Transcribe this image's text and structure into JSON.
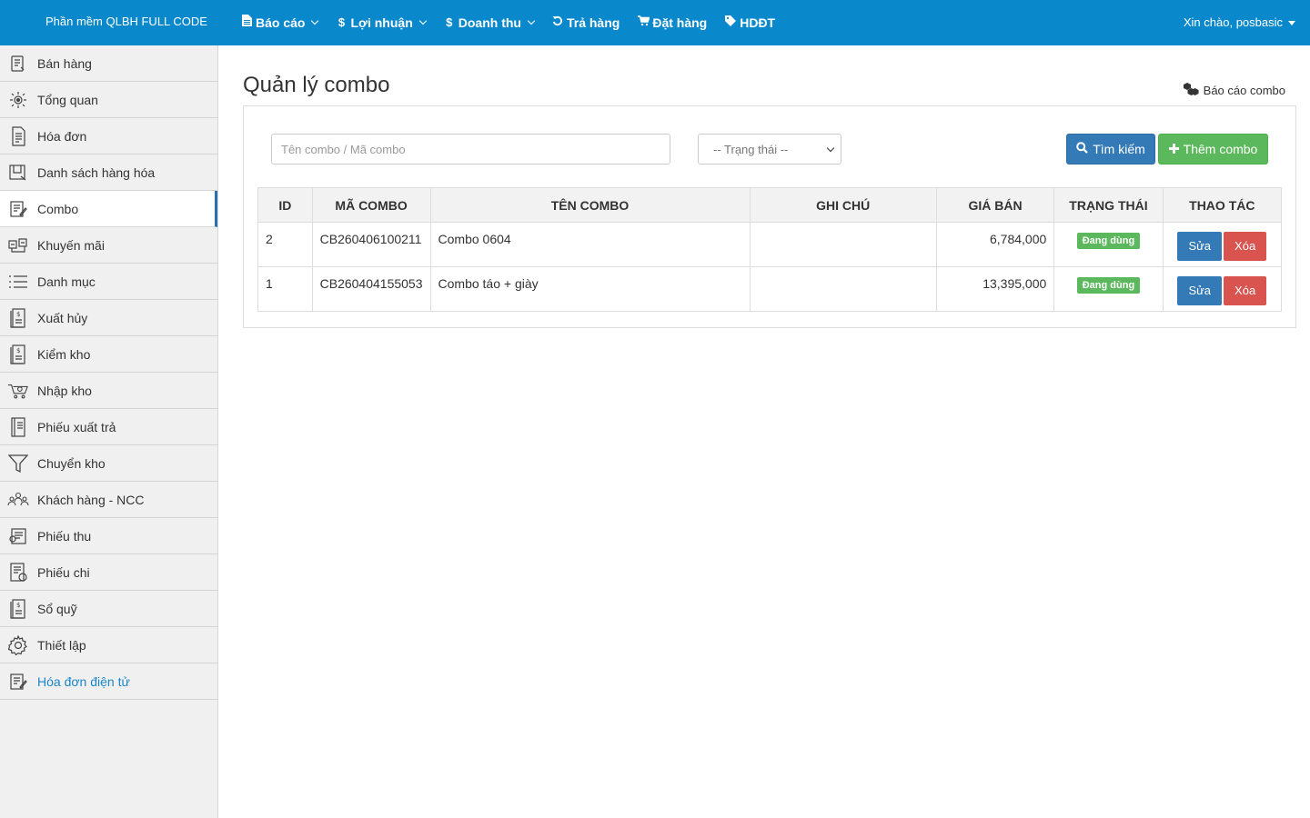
{
  "header": {
    "brand": "Phần mềm QLBH FULL CODE",
    "nav": [
      {
        "label": "Báo cáo",
        "icon": "file-icon",
        "dropdown": true
      },
      {
        "label": "Lợi nhuận",
        "icon": "dollar-icon",
        "dropdown": true
      },
      {
        "label": "Doanh thu",
        "icon": "dollar-icon",
        "dropdown": true
      },
      {
        "label": "Trả hàng",
        "icon": "undo-icon",
        "dropdown": false
      },
      {
        "label": "Đặt hàng",
        "icon": "cart-icon",
        "dropdown": false
      },
      {
        "label": "HDĐT",
        "icon": "tag-icon",
        "dropdown": false
      }
    ],
    "user": "Xin chào, posbasic"
  },
  "sidebar": {
    "items": [
      {
        "label": "Bán hàng",
        "icon": "sales-icon"
      },
      {
        "label": "Tổng quan",
        "icon": "overview-icon"
      },
      {
        "label": "Hóa đơn",
        "icon": "invoice-icon"
      },
      {
        "label": "Danh sách hàng hóa",
        "icon": "product-list-icon"
      },
      {
        "label": "Combo",
        "icon": "combo-icon",
        "active": true
      },
      {
        "label": "Khuyến mãi",
        "icon": "promotion-icon"
      },
      {
        "label": "Danh mục",
        "icon": "list-icon"
      },
      {
        "label": "Xuất hủy",
        "icon": "dollar-doc-icon"
      },
      {
        "label": "Kiểm kho",
        "icon": "dollar-doc-icon"
      },
      {
        "label": "Nhập kho",
        "icon": "cart-icon"
      },
      {
        "label": "Phiếu xuất trả",
        "icon": "notebook-icon"
      },
      {
        "label": "Chuyển kho",
        "icon": "funnel-icon"
      },
      {
        "label": "Khách hàng - NCC",
        "icon": "people-icon"
      },
      {
        "label": "Phiếu thu",
        "icon": "receipt-icon"
      },
      {
        "label": "Phiếu chi",
        "icon": "payment-icon"
      },
      {
        "label": "Sổ quỹ",
        "icon": "dollar-doc-icon"
      },
      {
        "label": "Thiết lập",
        "icon": "gear-icon"
      },
      {
        "label": "Hóa đơn điện tử",
        "icon": "e-invoice-icon",
        "link": true
      }
    ]
  },
  "main": {
    "title": "Quản lý combo",
    "report_link": "Báo cáo combo",
    "search_placeholder": "Tên combo / Mã combo",
    "status_select": "-- Trạng thái --",
    "search_button": "Tìm kiếm",
    "add_button": "Thêm combo",
    "table": {
      "headers": [
        "ID",
        "MÃ COMBO",
        "TÊN COMBO",
        "GHI CHÚ",
        "GIÁ BÁN",
        "TRẠNG THÁI",
        "THAO TÁC"
      ],
      "rows": [
        {
          "id": "2",
          "code": "CB260406100211",
          "name": "Combo 0604",
          "note": "",
          "price": "6,784,000",
          "status": "Đang dùng",
          "edit": "Sửa",
          "delete": "Xóa"
        },
        {
          "id": "1",
          "code": "CB260404155053",
          "name": "Combo táo + giày",
          "note": "",
          "price": "13,395,000",
          "status": "Đang dùng",
          "edit": "Sửa",
          "delete": "Xóa"
        }
      ]
    }
  },
  "colors": {
    "topbar": "#0a88cc",
    "primary": "#337ab7",
    "success": "#5cb85c",
    "danger": "#d9534f",
    "link": "#1a87c9"
  }
}
